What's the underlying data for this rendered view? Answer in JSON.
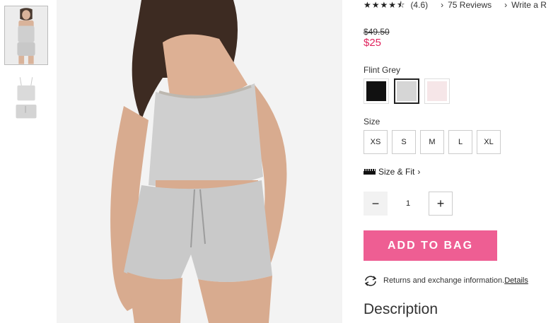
{
  "rating": {
    "stars": 4.6,
    "value_label": "(4.6)",
    "reviews_label": "75 Reviews",
    "write_label": "Write a R"
  },
  "price": {
    "original": "$49.50",
    "sale": "$25"
  },
  "color": {
    "label": "Flint Grey",
    "swatches": [
      {
        "name": "black",
        "hex": "#111111"
      },
      {
        "name": "flint-grey",
        "hex": "#d6d6d6"
      },
      {
        "name": "blush",
        "hex": "#f6e6e8"
      }
    ],
    "selected_index": 1
  },
  "size": {
    "label": "Size",
    "options": [
      "XS",
      "S",
      "M",
      "L",
      "XL"
    ]
  },
  "size_fit": {
    "label": "Size & Fit"
  },
  "quantity": {
    "value": "1"
  },
  "cta": {
    "add_to_bag": "ADD TO BAG",
    "color": "#ee5e93"
  },
  "returns": {
    "text": "Returns and exchange information.",
    "link": "Details"
  },
  "description": {
    "heading": "Description"
  }
}
